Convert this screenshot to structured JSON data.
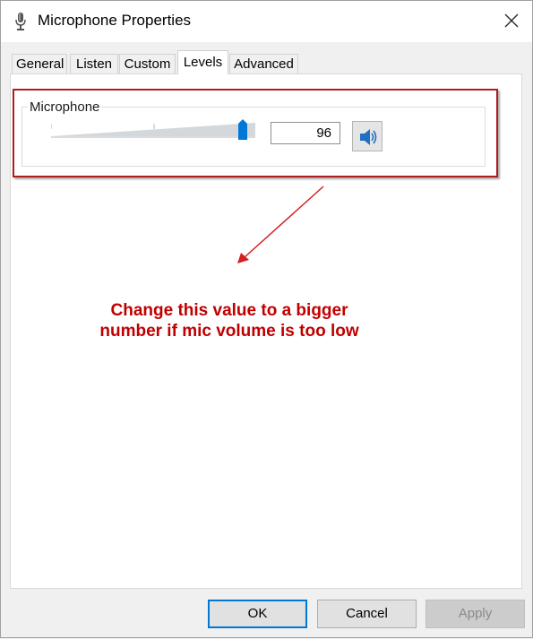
{
  "window": {
    "title": "Microphone Properties",
    "icon": "microphone-icon",
    "close_icon": "close-icon"
  },
  "tabs": [
    {
      "label": "General",
      "active": false
    },
    {
      "label": "Listen",
      "active": false
    },
    {
      "label": "Custom",
      "active": false
    },
    {
      "label": "Levels",
      "active": true
    },
    {
      "label": "Advanced",
      "active": false
    }
  ],
  "levels": {
    "group_label": "Microphone",
    "slider_value_percent": 96,
    "value": "96",
    "speaker_icon": "speaker-icon"
  },
  "annotation": {
    "line1": "Change this value to a bigger",
    "line2": "number if mic volume is too low",
    "color": "#c00000"
  },
  "buttons": {
    "ok": "OK",
    "cancel": "Cancel",
    "apply": "Apply"
  },
  "colors": {
    "accent": "#0078d7",
    "highlight_border": "#b01c1c"
  }
}
